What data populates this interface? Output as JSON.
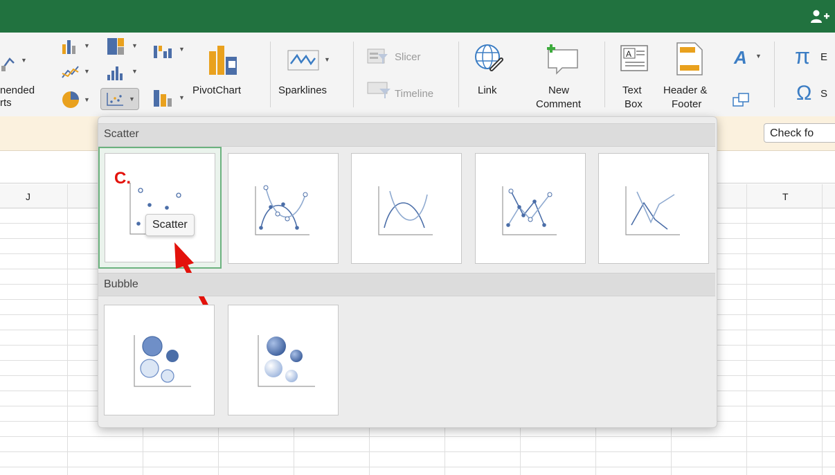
{
  "ribbon": {
    "recommended_charts_label_line1": "nended",
    "recommended_charts_label_line2": "rts",
    "pivotchart_label": "PivotChart",
    "sparklines_label": "Sparklines",
    "slicer_label": "Slicer",
    "timeline_label": "Timeline",
    "link_label": "Link",
    "new_comment_line1": "New",
    "new_comment_line2": "Comment",
    "text_box_line1": "Text",
    "text_box_line2": "Box",
    "header_footer_line1": "Header &",
    "header_footer_line2": "Footer",
    "equation_label": "E",
    "symbol_label": "S"
  },
  "infobar": {
    "check_button": "Check fo"
  },
  "columns": {
    "left": "J",
    "right": "T"
  },
  "gallery": {
    "scatter_section": "Scatter",
    "bubble_section": "Bubble",
    "annotation": "C.",
    "tooltip": "Scatter"
  },
  "colors": {
    "titlebar": "#21723f",
    "accent_selection": "#6bb27e",
    "chart_blue": "#4b6ea8",
    "annotation_red": "#e3120b"
  },
  "icons": [
    "share-person-icon",
    "recommended-charts-icon",
    "column-chart-icon",
    "line-chart-icon",
    "pie-chart-icon",
    "hierarchy-chart-icon",
    "statistic-chart-icon",
    "scatter-chart-icon",
    "waterfall-chart-icon",
    "combo-chart-icon",
    "pivotchart-icon",
    "sparklines-icon",
    "slicer-icon",
    "timeline-icon",
    "link-icon",
    "new-comment-icon",
    "text-box-icon",
    "header-footer-icon",
    "wordart-icon",
    "object-icon",
    "equation-icon",
    "symbol-icon"
  ]
}
